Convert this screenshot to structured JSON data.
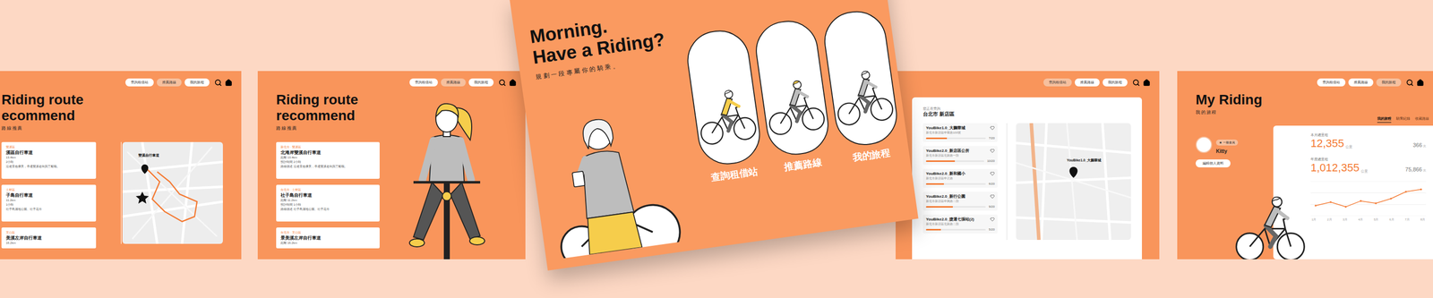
{
  "left_panel": {
    "nav": [
      {
        "label": "查詢租借站",
        "selected": false
      },
      {
        "label": "推薦路線",
        "selected": true
      },
      {
        "label": "我的旅程",
        "selected": false
      }
    ],
    "heading": [
      "Riding route",
      "ecommend"
    ],
    "subheading": "路線推薦",
    "routes": [
      {
        "region": "雙溪區",
        "name": "溪區自行車道",
        "lines": [
          "13.4km",
          "2小時",
          "沿途景色優美，串連雙溪老街與三貂嶺。"
        ]
      },
      {
        "region": "士林區",
        "name": "子島自行車道",
        "lines": [
          "11.2km",
          "1小時",
          "社子島濕地公園、社子花市"
        ]
      },
      {
        "region": "文山區",
        "name": "美溪左岸自行車道",
        "lines": [
          "16.2km"
        ]
      }
    ],
    "map": {
      "label": "雙溪自行車道"
    }
  },
  "route_panel": {
    "nav": [
      {
        "label": "查詢租借站",
        "selected": false
      },
      {
        "label": "推薦路線",
        "selected": true
      },
      {
        "label": "我的旅程",
        "selected": false
      }
    ],
    "heading": [
      "Riding route",
      "recommend"
    ],
    "subheading": "路線推薦",
    "routes": [
      {
        "region": "新北市 · 雙溪區",
        "name": "北海岸雙溪自行車道",
        "lines": [
          "距離 13.4km",
          "預計時間 2小時",
          "路線描述 沿途景色優美，串連雙溪老街與三貂嶺。"
        ]
      },
      {
        "region": "台北市 · 士林區",
        "name": "社子島自行車道",
        "lines": [
          "距離 11.2km",
          "預計時間 1小時",
          "路線描述 社子島濕地公園、社子花市"
        ]
      },
      {
        "region": "台北市 · 文山區",
        "name": "景美溪左岸自行車道",
        "lines": [
          "距離 16.2km"
        ]
      }
    ]
  },
  "hero": {
    "title": [
      "Morning.",
      "Have a Riding?"
    ],
    "subtitle": "規劃一段專屬你的騎乘。",
    "options": [
      {
        "label": "查詢租借站"
      },
      {
        "label": "推薦路線"
      },
      {
        "label": "我的旅程"
      }
    ]
  },
  "station_panel": {
    "nav": [
      {
        "label": "查詢租借站",
        "selected": true
      },
      {
        "label": "推薦路線",
        "selected": false
      },
      {
        "label": "我的旅程",
        "selected": false
      }
    ],
    "query_label": "您正在查詢",
    "location": "台北市 新店區",
    "stations": [
      {
        "name": "YouBike1.0_大鵬華城",
        "address": "新北市新店區中華路100號",
        "level": 0.35,
        "count": "7/20"
      },
      {
        "name": "YouBike2.0_新店區公所",
        "address": "新北市新店區北新路一段",
        "level": 0.5,
        "count": "10/20"
      },
      {
        "name": "YouBike2.0_新和國小",
        "address": "新北市新店區中正路",
        "level": 0.3,
        "count": "6/20"
      },
      {
        "name": "YouBike2.0_新行公園",
        "address": "新北市新店區中興路二段",
        "level": 0.45,
        "count": "9/20"
      },
      {
        "name": "YouBike2.0_捷運七張站(2)",
        "address": "新北市新店區北新路二段",
        "level": 0.25,
        "count": "5/20"
      }
    ],
    "map": {
      "label": "YouBike1.0_大鵬華城"
    }
  },
  "riding_panel": {
    "nav": [
      {
        "label": "查詢租借站",
        "selected": false
      },
      {
        "label": "推薦路線",
        "selected": false
      },
      {
        "label": "我的旅程",
        "selected": true
      }
    ],
    "heading": "My Riding",
    "subheading": "我的旅程",
    "tabs": [
      {
        "label": "我的旅程",
        "selected": true
      },
      {
        "label": "騎乘紀錄",
        "selected": false
      },
      {
        "label": "收藏路線",
        "selected": false
      }
    ],
    "profile": {
      "badge": "★ 一般會員",
      "name": "Kitty",
      "button": "編輯個人資料"
    },
    "stats": [
      {
        "label": "本月總里程",
        "value": "12,355",
        "unit": "公里",
        "side": "366",
        "side_unit": "次"
      },
      {
        "label": "年度總里程",
        "value": "1,012,355",
        "unit": "公里",
        "side": "75,866",
        "side_unit": "次"
      }
    ],
    "chart": {
      "x_labels": [
        "1月",
        "2月",
        "3月",
        "4月",
        "5月",
        "6月",
        "7月",
        "8月"
      ],
      "values": [
        18,
        24,
        16,
        26,
        22,
        30,
        42,
        46
      ]
    }
  }
}
